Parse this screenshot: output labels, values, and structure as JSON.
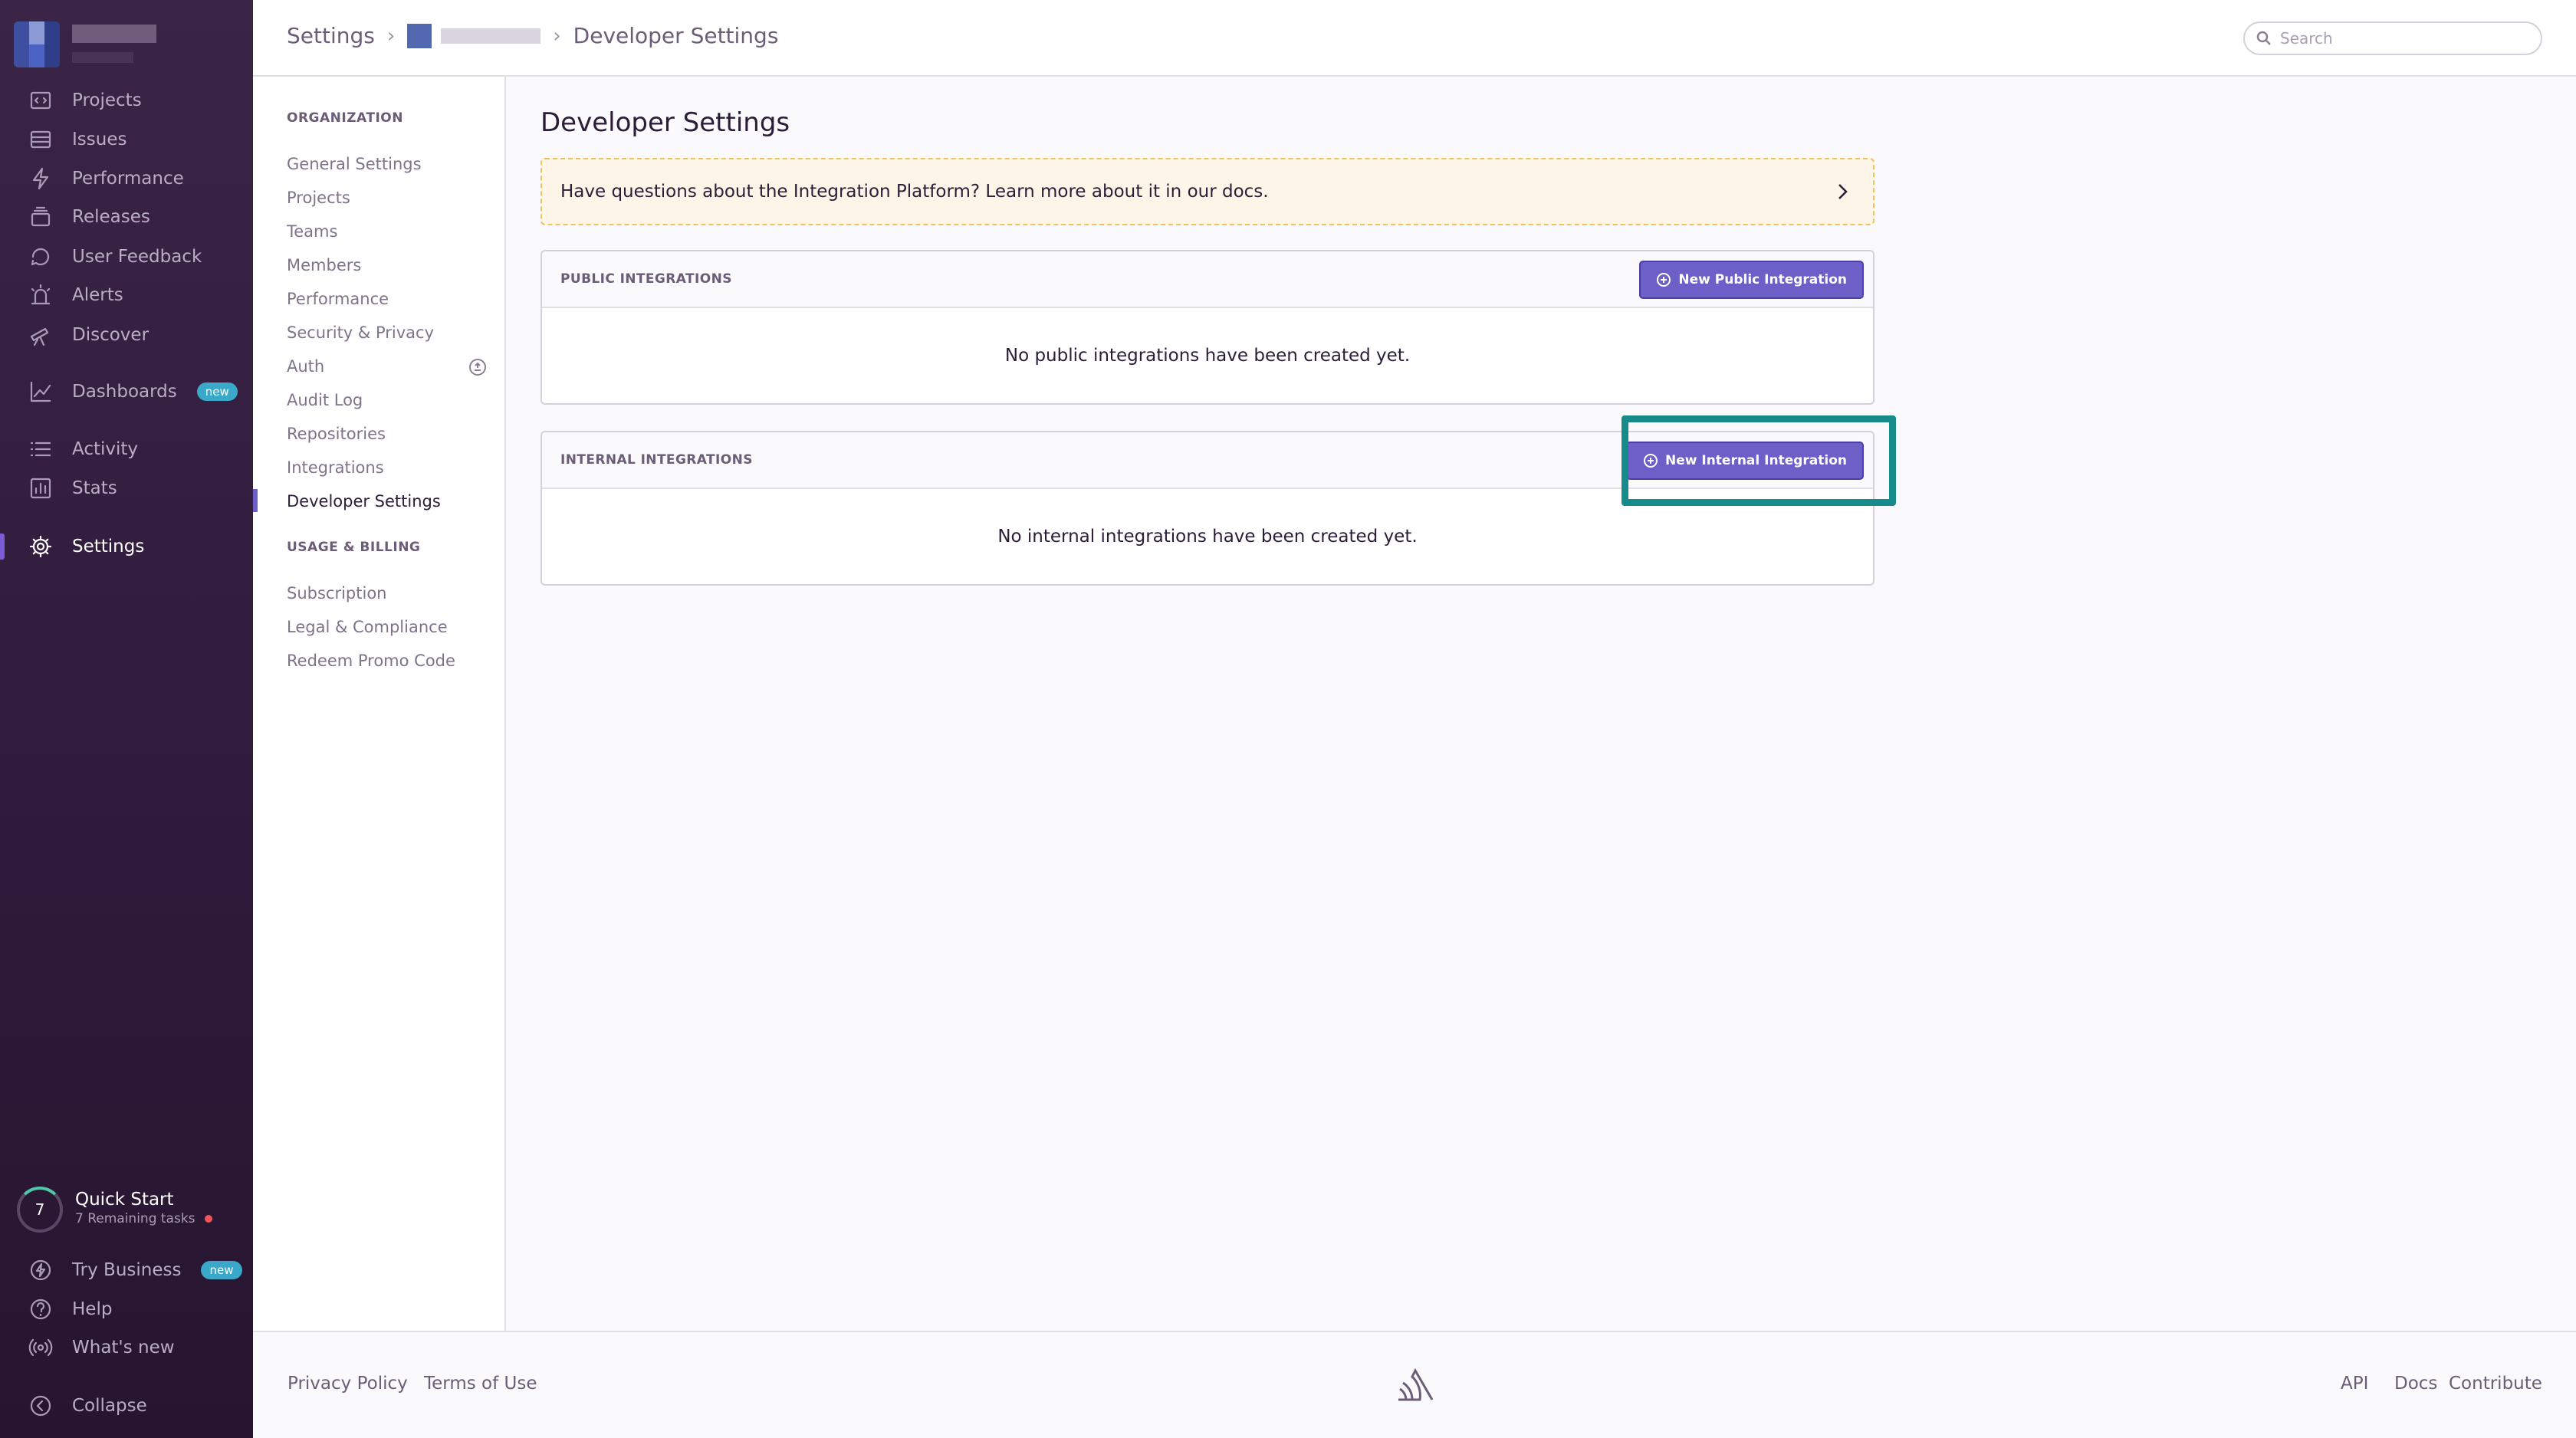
{
  "sidebar": {
    "items": [
      {
        "label": "Projects",
        "icon": "projects-icon"
      },
      {
        "label": "Issues",
        "icon": "issues-icon"
      },
      {
        "label": "Performance",
        "icon": "lightning-icon"
      },
      {
        "label": "Releases",
        "icon": "releases-icon"
      },
      {
        "label": "User Feedback",
        "icon": "feedback-icon"
      },
      {
        "label": "Alerts",
        "icon": "siren-icon"
      },
      {
        "label": "Discover",
        "icon": "telescope-icon"
      },
      {
        "label": "Dashboards",
        "icon": "chart-icon",
        "badge": "new"
      },
      {
        "label": "Activity",
        "icon": "list-icon"
      },
      {
        "label": "Stats",
        "icon": "bar-chart-icon"
      },
      {
        "label": "Settings",
        "icon": "gear-icon"
      }
    ],
    "quick_start": {
      "count": "7",
      "title": "Quick Start",
      "subtitle": "7 Remaining tasks"
    },
    "bottom": [
      {
        "label": "Try Business",
        "icon": "lightning-circle-icon",
        "badge": "new"
      },
      {
        "label": "Help",
        "icon": "question-icon"
      },
      {
        "label": "What's new",
        "icon": "broadcast-icon"
      },
      {
        "label": "Collapse",
        "icon": "collapse-icon"
      }
    ]
  },
  "header": {
    "breadcrumb_root": "Settings",
    "breadcrumb_current": "Developer Settings",
    "search_placeholder": "Search"
  },
  "subnav": {
    "org_section": "ORGANIZATION",
    "org_items": [
      "General Settings",
      "Projects",
      "Teams",
      "Members",
      "Performance",
      "Security & Privacy",
      "Auth",
      "Audit Log",
      "Repositories",
      "Integrations",
      "Developer Settings"
    ],
    "billing_section": "USAGE & BILLING",
    "billing_items": [
      "Subscription",
      "Legal & Compliance",
      "Redeem Promo Code"
    ]
  },
  "main": {
    "title": "Developer Settings",
    "alert": "Have questions about the Integration Platform? Learn more about it in our docs.",
    "public": {
      "label": "PUBLIC INTEGRATIONS",
      "button": "New Public Integration",
      "empty": "No public integrations have been created yet."
    },
    "internal": {
      "label": "INTERNAL INTEGRATIONS",
      "button": "New Internal Integration",
      "empty": "No internal integrations have been created yet."
    }
  },
  "footer": {
    "privacy": "Privacy Policy",
    "terms": "Terms of Use",
    "api": "API",
    "docs": "Docs",
    "contribute": "Contribute"
  },
  "colors": {
    "accent": "#6c5fc7",
    "highlight": "#178a8a",
    "sidebar": "#2e1a3a"
  }
}
